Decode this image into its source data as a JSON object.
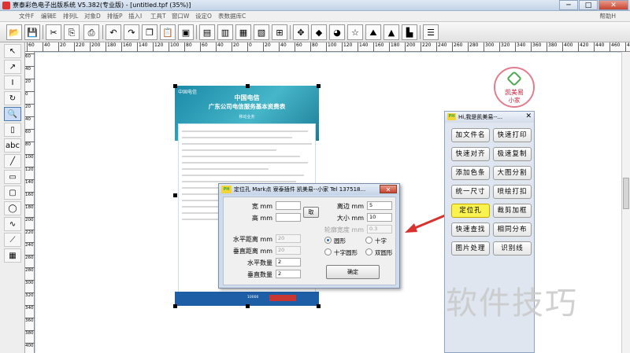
{
  "window": {
    "title": "寮泰彩色电子出版系统 V5.382(专业版) - [untitled.tpf (35%)]",
    "minimize": "─",
    "maximize": "□",
    "close": "✕"
  },
  "menu": {
    "items": [
      "文件F",
      "编辑E",
      "排列L",
      "对象D",
      "排版P",
      "插入I",
      "工具T",
      "窗口W",
      "设定O",
      "表数据库C"
    ],
    "help": "帮助H"
  },
  "ruler": {
    "top_labels": [
      "60",
      "40",
      "20",
      "220",
      "200",
      "180",
      "160",
      "140",
      "120",
      "100",
      "80",
      "60",
      "40",
      "20",
      "0",
      "20",
      "40",
      "60",
      "80",
      "100",
      "120",
      "140",
      "160",
      "180",
      "200",
      "220",
      "240",
      "260",
      "280",
      "300",
      "320",
      "340",
      "360",
      "380",
      "400",
      "420",
      "440",
      "460",
      "480"
    ],
    "left_labels": [
      "60",
      "40",
      "20",
      "0",
      "20",
      "40",
      "60",
      "80",
      "100",
      "120",
      "140",
      "160",
      "180",
      "200",
      "220",
      "240",
      "260",
      "280",
      "300",
      "320",
      "340",
      "360",
      "380",
      "400"
    ]
  },
  "document": {
    "logo": "中国电信",
    "title_line1": "中国电信",
    "title_line2": "广东公司电信服务基本资费表",
    "subtitle": "移动业务",
    "footer_text": "10000"
  },
  "dialog": {
    "icon": "PH",
    "title": "定位孔  Mark点 寮泰插件 凯美易--小家 Tel 137518...",
    "close": "✕",
    "width_label": "宽 mm",
    "height_label": "高 mm",
    "take_button": "取",
    "margin_label": "离边 mm",
    "margin_value": "5",
    "size_label": "大小 mm",
    "size_value": "10",
    "outline_label": "轮廓宽度 mm",
    "outline_value": "0.3",
    "hspacing_label": "水平距离 mm",
    "hspacing_value": "20",
    "vspacing_label": "垂直距离 mm",
    "vspacing_value": "20",
    "hcount_label": "水平数量",
    "hcount_value": "2",
    "vcount_label": "垂直数量",
    "vcount_value": "2",
    "shape_circle": "圆形",
    "shape_cross": "十字",
    "shape_cross_circle": "十字圆形",
    "shape_double_circle": "双圆形",
    "ok_button": "确定"
  },
  "panel": {
    "icon": "PH",
    "title": "Hi,我是凯美易--...",
    "close": "✕",
    "buttons": [
      "加文件名",
      "快速打印",
      "快速对齐",
      "极速复制",
      "添加色条",
      "大图分割",
      "统一尺寸",
      "喷绘打扣",
      "定位孔",
      "裁剪加框",
      "快速查找",
      "相同分布",
      "图片处理",
      "识别线"
    ],
    "highlight_color": "#f9f24f"
  },
  "badge": {
    "line1": "凯美易",
    "line2": "小家"
  },
  "watermark": "软件技巧"
}
